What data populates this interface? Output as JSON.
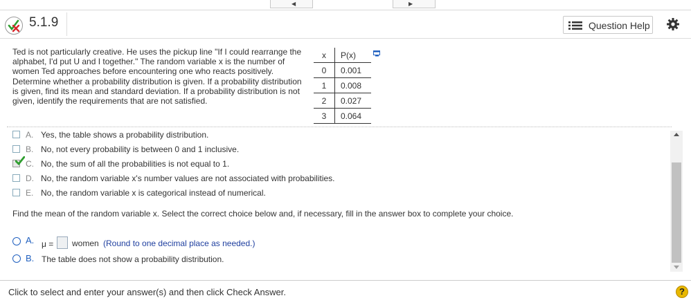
{
  "question": {
    "number": "5.1.9",
    "help_label": "Question Help"
  },
  "problem": {
    "text": "Ted is not particularly creative. He uses the pickup line \"If I could rearrange the alphabet, I'd put U and I together.\" The random variable x is the number of women Ted approaches before encountering one who reacts positively. Determine whether a probability distribution is given. If a probability distribution is given, find its mean and standard deviation. If a probability distribution is not given, identify the requirements that are not satisfied."
  },
  "table": {
    "headers": [
      "x",
      "P(x)"
    ],
    "rows": [
      [
        "0",
        "0.001"
      ],
      [
        "1",
        "0.008"
      ],
      [
        "2",
        "0.027"
      ],
      [
        "3",
        "0.064"
      ]
    ]
  },
  "part1_choices": [
    {
      "letter": "A.",
      "text": "Yes, the table shows a probability distribution.",
      "checked": false
    },
    {
      "letter": "B.",
      "text": "No, not every probability is between 0 and 1 inclusive.",
      "checked": false
    },
    {
      "letter": "C.",
      "text": "No, the sum of all the probabilities is not equal to 1.",
      "checked": true
    },
    {
      "letter": "D.",
      "text": "No, the random variable x's number values are not associated with probabilities.",
      "checked": false
    },
    {
      "letter": "E.",
      "text": "No, the random variable x is categorical instead of numerical.",
      "checked": false
    }
  ],
  "part2": {
    "prompt": "Find the mean of the random variable x. Select the correct choice below and, if necessary, fill in the answer box to complete your choice.",
    "option_a": {
      "letter": "A.",
      "prefix": "μ =",
      "answer_value": "",
      "unit": "women",
      "hint": "(Round to one decimal place as needed.)"
    },
    "option_b": {
      "letter": "B.",
      "text": "The table does not show a probability distribution."
    }
  },
  "footer": {
    "instruction": "Click to select and enter your answer(s) and then click Check Answer.",
    "help_symbol": "?"
  },
  "colors": {
    "accent": "#1f5fbf",
    "check": "#2e9e2e",
    "wrong_mark": "#d9262b",
    "help_badge": "#e8b800"
  }
}
